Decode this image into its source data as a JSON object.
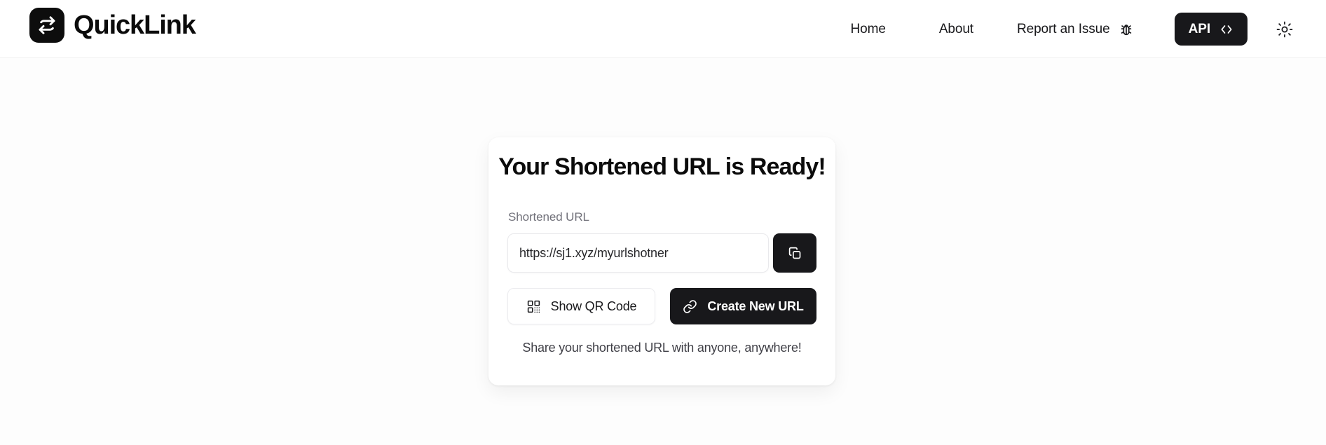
{
  "header": {
    "brand": {
      "name": "QuickLink",
      "icon": "shuffle-arrows-icon"
    },
    "nav_links": [
      {
        "label": "Home",
        "name": "nav-link-home"
      },
      {
        "label": "About",
        "name": "nav-link-about"
      },
      {
        "label": "Report an Issue",
        "name": "nav-link-report-an-issue"
      }
    ],
    "bug_icon": "bug-icon",
    "api_button": {
      "label": "API",
      "icon": "code-brackets-icon"
    },
    "theme_toggle": {
      "icon": "sun-icon"
    }
  },
  "card": {
    "title": "Your Shortened URL is Ready!",
    "field_label": "Shortened URL",
    "url_value": "https://sj1.xyz/myurlshotner",
    "url_placeholder": "https://sj1.xyz/myurlshotner",
    "copy_button": {
      "icon": "copy-icon",
      "aria_label": "Copy"
    },
    "qr_button": {
      "label": "Show QR Code",
      "icon": "qr-code-icon"
    },
    "create_button": {
      "label": "Create New URL",
      "icon": "link-icon"
    },
    "footnote": "Share your shortened URL with anyone, anywhere!"
  },
  "colors": {
    "accent": "#18181b",
    "page_background": "#fdfdfd",
    "header_background": "#ffffff",
    "card_background": "#ffffff",
    "muted_text": "#71717a",
    "border": "#ececef"
  }
}
